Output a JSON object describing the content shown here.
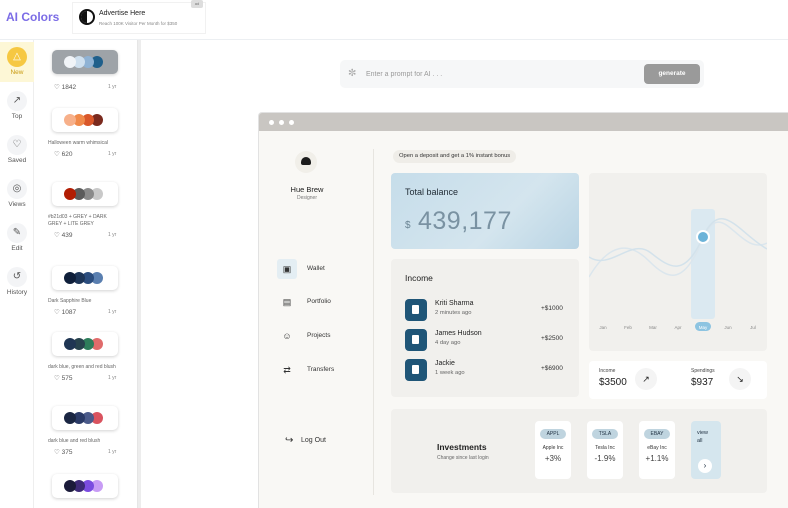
{
  "app": {
    "title": "AI Colors"
  },
  "ad": {
    "title": "Advertise Here",
    "subtitle": "Reach 100K Visitor Per Month for $350",
    "tag": "ad"
  },
  "nav": [
    {
      "label": "New",
      "icon": "lightbulb-icon",
      "active": true
    },
    {
      "label": "Top",
      "icon": "trending-icon"
    },
    {
      "label": "Saved",
      "icon": "heart-icon"
    },
    {
      "label": "Views",
      "icon": "views-icon"
    },
    {
      "label": "Edit",
      "icon": "pencil-icon"
    },
    {
      "label": "History",
      "icon": "history-icon"
    }
  ],
  "palettes": [
    {
      "name": "",
      "likes": "1842",
      "age": "1 yr",
      "colors": [
        "#f1f4f8",
        "#cfe0ef",
        "#8fb2d4",
        "#1f5f8b"
      ],
      "selected": true
    },
    {
      "name": "Halloween warm whimsical",
      "likes": "620",
      "age": "1 yr",
      "colors": [
        "#f7b08a",
        "#f08a4b",
        "#d9572a",
        "#7a2a1e"
      ]
    },
    {
      "name": "#b21d03 + GREY + DARK GREY + LITE GREY",
      "likes": "439",
      "age": "1 yr",
      "colors": [
        "#b21d03",
        "#5b5b5b",
        "#8a8a8a",
        "#c9c9c9"
      ]
    },
    {
      "name": "Dark Sapphire Blue",
      "likes": "1087",
      "age": "1 yr",
      "colors": [
        "#0f1f3a",
        "#1d3557",
        "#2b4d7e",
        "#5a7fb0"
      ]
    },
    {
      "name": "dark blue, green and red blush",
      "likes": "575",
      "age": "1 yr",
      "colors": [
        "#1f3553",
        "#27424d",
        "#2e7d5b",
        "#e06b6b"
      ]
    },
    {
      "name": "dark blue and red blush",
      "likes": "375",
      "age": "1 yr",
      "colors": [
        "#1a2642",
        "#2a3a66",
        "#4a5a8a",
        "#d9535f"
      ]
    },
    {
      "name": "",
      "likes": "",
      "age": "",
      "colors": [
        "#1b1b3a",
        "#3d2a77",
        "#7b4ce0",
        "#c89cf5"
      ]
    }
  ],
  "prompt": {
    "placeholder": "Enter a prompt for AI . . .",
    "button": "generate"
  },
  "mock": {
    "profile": {
      "name": "Hue Brew",
      "role": "Designer"
    },
    "menu": [
      {
        "label": "Wallet",
        "icon": "wallet-icon",
        "active": true
      },
      {
        "label": "Portfolio",
        "icon": "chart-icon"
      },
      {
        "label": "Projects",
        "icon": "people-icon"
      },
      {
        "label": "Transfers",
        "icon": "transfer-icon"
      }
    ],
    "logout": "Log Out",
    "bonus": "Open a deposit and get a 1% instant bonus",
    "balance": {
      "title": "Total balance",
      "currency": "$",
      "amount": "439,177"
    },
    "income": {
      "title": "Income",
      "rows": [
        {
          "name": "Kriti Sharma",
          "time": "2 minutes ago",
          "amount": "+$1000"
        },
        {
          "name": "James Hudson",
          "time": "4 day ago",
          "amount": "+$2500"
        },
        {
          "name": "Jackie",
          "time": "1 week ago",
          "amount": "+$6900"
        }
      ]
    },
    "chart": {
      "months": [
        "Jan",
        "Feb",
        "Mar",
        "Apr",
        "May",
        "Jun",
        "Jul"
      ],
      "highlight_index": 4
    },
    "summary": {
      "income_label": "Income",
      "income_value": "$3500",
      "spend_label": "Spendings",
      "spend_value": "$937"
    },
    "investments": {
      "title": "Investments",
      "subtitle": "Change since last login",
      "stocks": [
        {
          "ticker": "APPL",
          "company": "Apple Inc",
          "change": "+3%"
        },
        {
          "ticker": "TSLA",
          "company": "Tesla Inc",
          "change": "-1.9%"
        },
        {
          "ticker": "EBAY",
          "company": "eBay Inc",
          "change": "+1.1%"
        }
      ],
      "view_all": "view all"
    }
  }
}
